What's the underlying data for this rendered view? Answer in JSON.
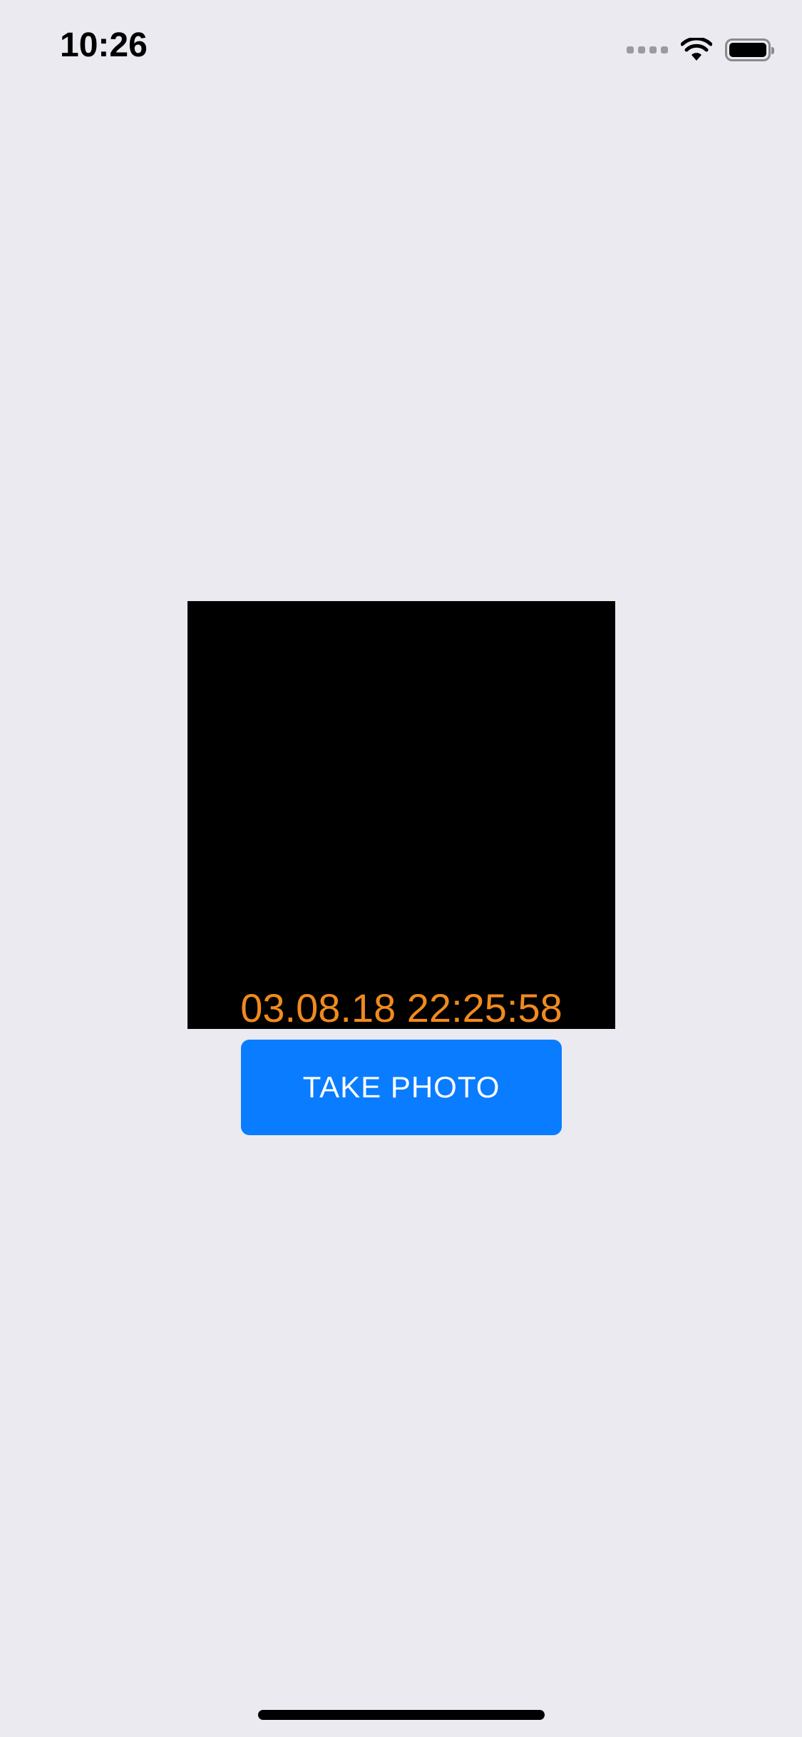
{
  "status_bar": {
    "time": "10:26",
    "icons": [
      "cellular-signal-icon",
      "wifi-icon",
      "battery-icon"
    ]
  },
  "camera": {
    "timestamp": "03.08.18 22:25:58",
    "timestamp_color": "#f08a1e",
    "preview_background": "#000000"
  },
  "actions": {
    "take_photo_label": "TAKE PHOTO",
    "button_color": "#0a7cff"
  }
}
